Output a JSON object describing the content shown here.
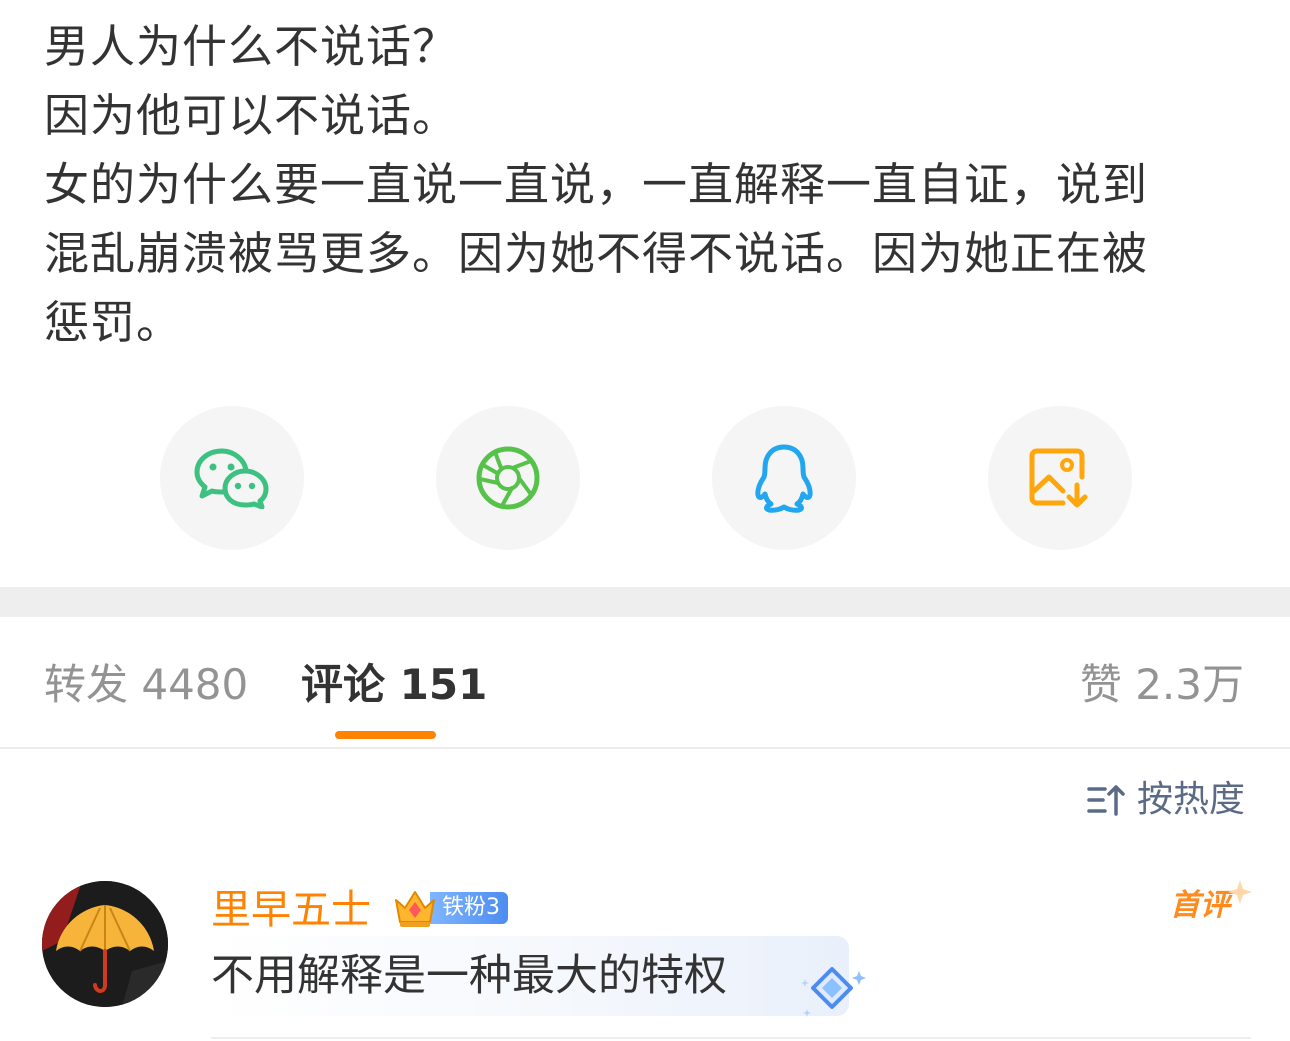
{
  "post": {
    "lines": [
      "男人为什么不说话？",
      "因为他可以不说话。",
      "女的为什么要一直说一直说，一直解释一直自证，说到",
      "混乱崩溃被骂更多。因为她不得不说话。因为她正在被",
      "惩罚。"
    ]
  },
  "share": {
    "buttons": [
      {
        "icon": "wechat-icon",
        "color": "#3dc181"
      },
      {
        "icon": "moments-icon",
        "color": "#56c24a"
      },
      {
        "icon": "qq-icon",
        "color": "#22a6f0"
      },
      {
        "icon": "save-image-icon",
        "color": "#ffa60c"
      }
    ]
  },
  "tabs": {
    "repost": "转发 4480",
    "comment": "评论 151",
    "like": "赞 2.3万",
    "accent": "#ff8200"
  },
  "sort": {
    "label": "按热度"
  },
  "comment": {
    "username": "里早五士",
    "fan_badge": "铁粉3",
    "first_tag": "首评",
    "text": "不用解释是一种最大的特权"
  }
}
